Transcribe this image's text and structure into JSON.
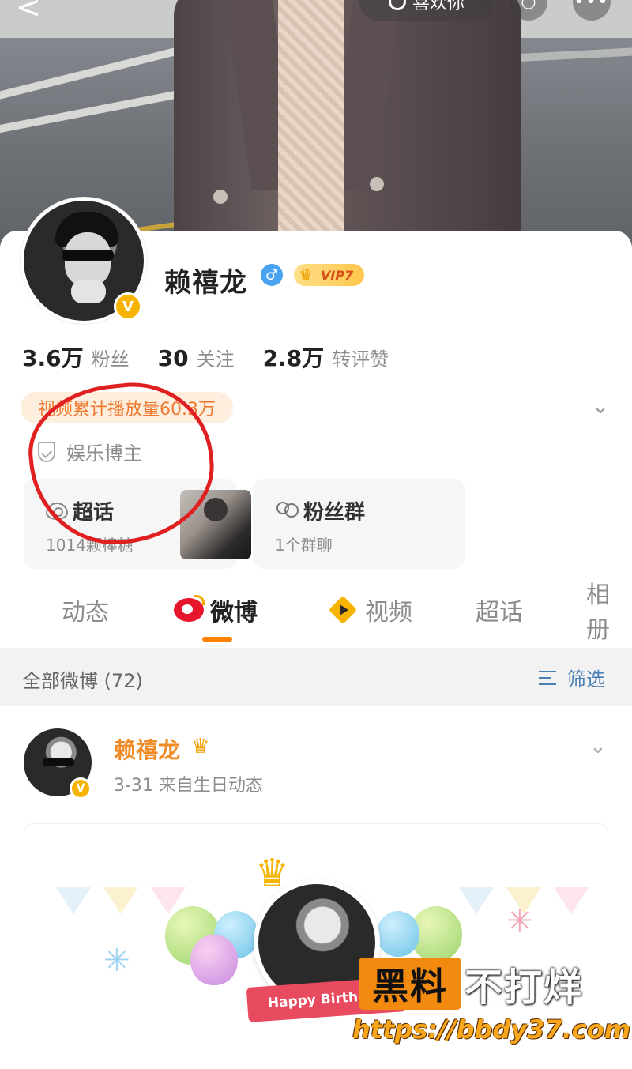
{
  "topbar": {
    "back_glyph": "<",
    "pill_label": "喜欢你",
    "search_glyph": "○",
    "more_glyph": "•••"
  },
  "profile": {
    "name": "赖禧龙",
    "gender_glyph": "♂",
    "vip_label": "VIP7",
    "verify_glyph": "V",
    "stats": [
      {
        "num": "3.6万",
        "label": "粉丝"
      },
      {
        "num": "30",
        "label": "关注"
      },
      {
        "num": "2.8万",
        "label": "转评赞"
      }
    ],
    "video_pill": "视频累计播放量60.3万",
    "tag": "娱乐博主",
    "tiles": {
      "supertopic": {
        "title": "超话",
        "sub": "1014颗棒糖"
      },
      "fans": {
        "title": "粉丝群",
        "sub": "1个群聊"
      }
    }
  },
  "tabs": [
    {
      "label": "动态",
      "active": false
    },
    {
      "label": "微博",
      "active": true
    },
    {
      "label": "视频",
      "active": false
    },
    {
      "label": "超话",
      "active": false
    },
    {
      "label": "相册",
      "active": false
    }
  ],
  "filter": {
    "label": "全部微博 (72)",
    "button": "筛选"
  },
  "post": {
    "author": "赖禧龙",
    "crown_glyph": "♛",
    "meta": "3-31  来自生日动态",
    "ribbon": "Happy Birthday"
  },
  "watermark": {
    "box": "黑料",
    "text": "不打烊",
    "url": "https://bbdy37.com"
  },
  "colors": {
    "accent": "#ff8200",
    "brand_red": "#e6162d",
    "link": "#4a7fb5",
    "marker": "#e02020"
  }
}
